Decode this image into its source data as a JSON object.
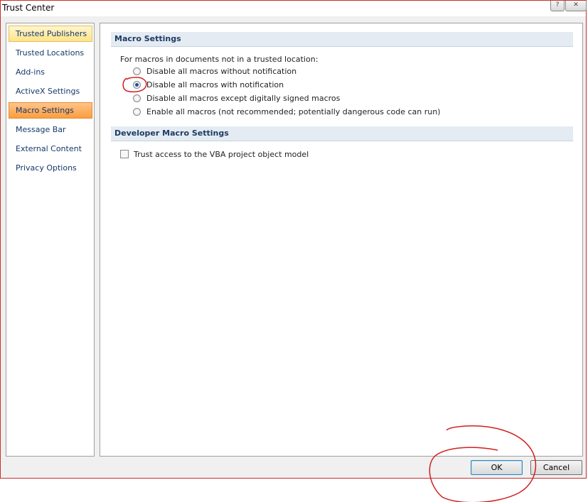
{
  "window": {
    "title": "Trust Center",
    "help_glyph": "?",
    "close_glyph": "✕"
  },
  "sidebar": {
    "items": [
      {
        "label": "Trusted Publishers",
        "state": "hover"
      },
      {
        "label": "Trusted Locations",
        "state": "normal"
      },
      {
        "label": "Add-ins",
        "state": "normal"
      },
      {
        "label": "ActiveX Settings",
        "state": "normal"
      },
      {
        "label": "Macro Settings",
        "state": "selected"
      },
      {
        "label": "Message Bar",
        "state": "normal"
      },
      {
        "label": "External Content",
        "state": "normal"
      },
      {
        "label": "Privacy Options",
        "state": "normal"
      }
    ]
  },
  "macro_settings": {
    "header": "Macro Settings",
    "intro": "For macros in documents not in a trusted location:",
    "options": [
      {
        "label": "Disable all macros without notification",
        "checked": false
      },
      {
        "label": "Disable all macros with notification",
        "checked": true
      },
      {
        "label": "Disable all macros except digitally signed macros",
        "checked": false
      },
      {
        "label": "Enable all macros (not recommended; potentially dangerous code can run)",
        "checked": false
      }
    ]
  },
  "developer_settings": {
    "header": "Developer Macro Settings",
    "vba_label": "Trust access to the VBA project object model",
    "vba_checked": false
  },
  "buttons": {
    "ok": "OK",
    "cancel": "Cancel"
  },
  "colors": {
    "annotation": "#d21f1f",
    "selected_nav": "#fb9d3e",
    "hover_nav": "#ffe48a",
    "section_header": "#e4ebf2"
  }
}
